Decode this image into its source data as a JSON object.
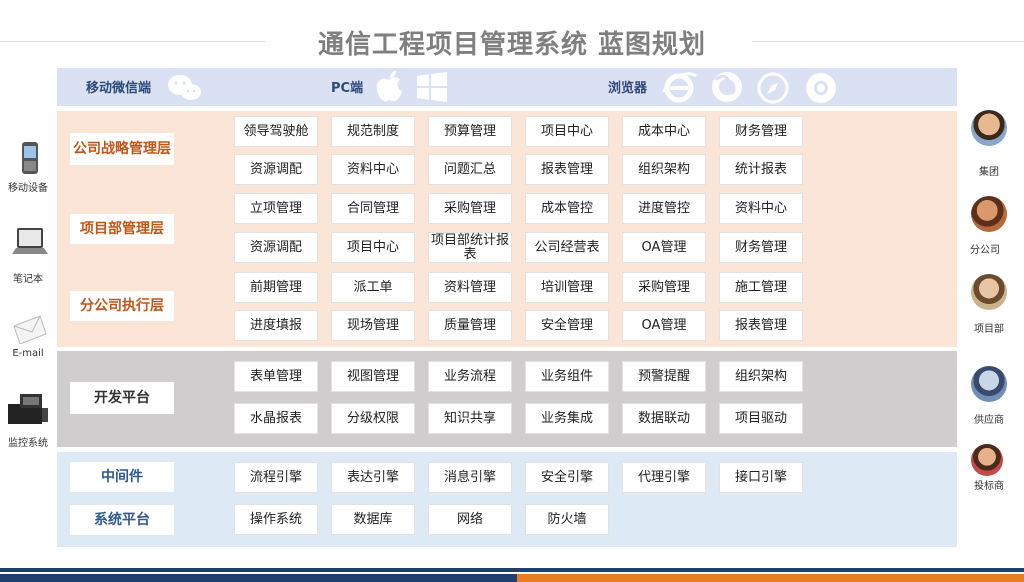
{
  "title": "通信工程项目管理系统 蓝图规划",
  "top_band": {
    "mobile": "移动微信端",
    "pc": "PC端",
    "browser": "浏览器"
  },
  "layers": {
    "strategy": "公司战略管理层",
    "project": "项目部管理层",
    "branch": "分公司执行层",
    "dev": "开发平台",
    "middleware": "中间件",
    "system": "系统平台"
  },
  "grid": {
    "row1": [
      "领导驾驶舱",
      "规范制度",
      "预算管理",
      "项目中心",
      "成本中心",
      "财务管理"
    ],
    "row2": [
      "资源调配",
      "资料中心",
      "问题汇总",
      "报表管理",
      "组织架构",
      "统计报表"
    ],
    "row3": [
      "立项管理",
      "合同管理",
      "采购管理",
      "成本管控",
      "进度管控",
      "资料中心"
    ],
    "row4": [
      "资源调配",
      "项目中心",
      "项目部统计报表",
      "公司经营表",
      "OA管理",
      "财务管理"
    ],
    "row5": [
      "前期管理",
      "派工单",
      "资料管理",
      "培训管理",
      "采购管理",
      "施工管理"
    ],
    "row6": [
      "进度填报",
      "现场管理",
      "质量管理",
      "安全管理",
      "OA管理",
      "报表管理"
    ],
    "dev1": [
      "表单管理",
      "视图管理",
      "业务流程",
      "业务组件",
      "预警提醒",
      "组织架构"
    ],
    "dev2": [
      "水晶报表",
      "分级权限",
      "知识共享",
      "业务集成",
      "数据联动",
      "项目驱动"
    ],
    "mid": [
      "流程引擎",
      "表达引擎",
      "消息引擎",
      "安全引擎",
      "代理引擎",
      "接口引擎"
    ],
    "sys": [
      "操作系统",
      "数据库",
      "网络",
      "防火墙"
    ]
  },
  "left_devices": [
    "移动设备",
    "笔记本",
    "E-mail",
    "监控系统"
  ],
  "right_users": [
    "集团",
    "分公司",
    "项目部",
    "供应商",
    "投标商"
  ],
  "colors": {
    "top_band": "#d9e1f2",
    "mgmt_band": "#fbe5d6",
    "dev_band": "#cfcdcd",
    "sys_band": "#dde9f5",
    "bar_blue": "#1f3f6e",
    "bar_orange": "#e97d24"
  },
  "icons": [
    "wechat-icon",
    "apple-icon",
    "windows-icon",
    "ie-icon",
    "firefox-icon",
    "safari-icon",
    "chrome-icon",
    "mobile-icon",
    "laptop-icon",
    "email-icon",
    "monitor-icon"
  ]
}
